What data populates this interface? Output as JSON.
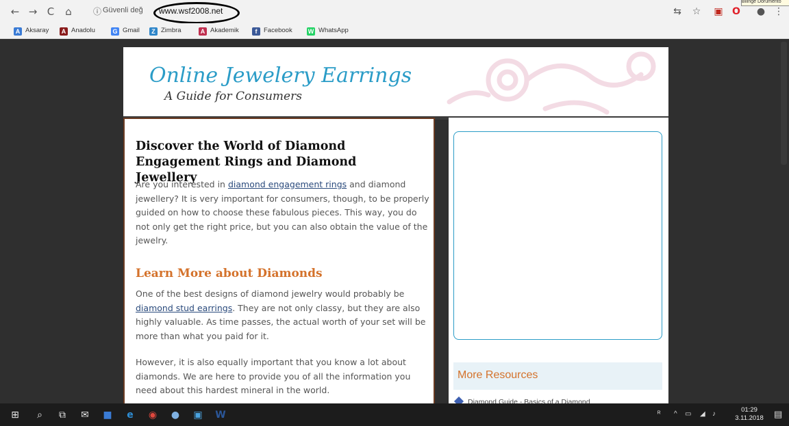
{
  "browser": {
    "info_icon": "ⓘ",
    "secure_label": "Güvenli değ",
    "url": "www.wsf2008.net",
    "tooltip": "Bilinge Dorumento"
  },
  "bookmarks": [
    {
      "label": "Aksaray",
      "icon": "A",
      "color": "#3a7bd5"
    },
    {
      "label": "Anadolu",
      "icon": "A",
      "color": "#8a1c1c"
    },
    {
      "label": "Gmail",
      "icon": "G",
      "color": "#4285f4"
    },
    {
      "label": "Zimbra",
      "icon": "Z",
      "color": "#2f86c9"
    },
    {
      "label": "Akademik",
      "icon": "A",
      "color": "#c03050"
    },
    {
      "label": "Facebook",
      "icon": "f",
      "color": "#3b5998"
    },
    {
      "label": "WhatsApp",
      "icon": "W",
      "color": "#25d366"
    }
  ],
  "header": {
    "title": "Online Jewelery Earrings",
    "subtitle": "A Guide for Consumers"
  },
  "main": {
    "heading": "Discover the World of Diamond Engagement Rings and Diamond Jewellery",
    "p1_before": "Are you interested in ",
    "p1_link": "diamond engagement rings",
    "p1_after": " and diamond jewellery? It is very important for consumers, though, to be properly guided on how to choose these fabulous pieces. This way, you do not only get the right price, but you can also obtain the value of the jewelry.",
    "subheading": "Learn More about Diamonds",
    "p2_before": "One of the best designs of diamond jewelry would probably be ",
    "p2_link": "diamond stud earrings",
    "p2_after": ". They are not only classy, but they are also highly valuable. As time passes, the actual worth of your set will be more than what you paid for it.",
    "p3": "However, it is also equally important that you know a lot about diamonds. We are here to provide you of all the information you need about this hardest mineral in the world."
  },
  "sidebar": {
    "more_resources": "More Resources",
    "resource_link": "Diamond Guide - Basics of a Diamond"
  },
  "taskbar": {
    "time": "01:29",
    "date": "3.11.2018"
  },
  "colors": {
    "accent_blue": "#2a9cc7",
    "accent_orange": "#d4722b",
    "link": "#2a4a7c"
  }
}
